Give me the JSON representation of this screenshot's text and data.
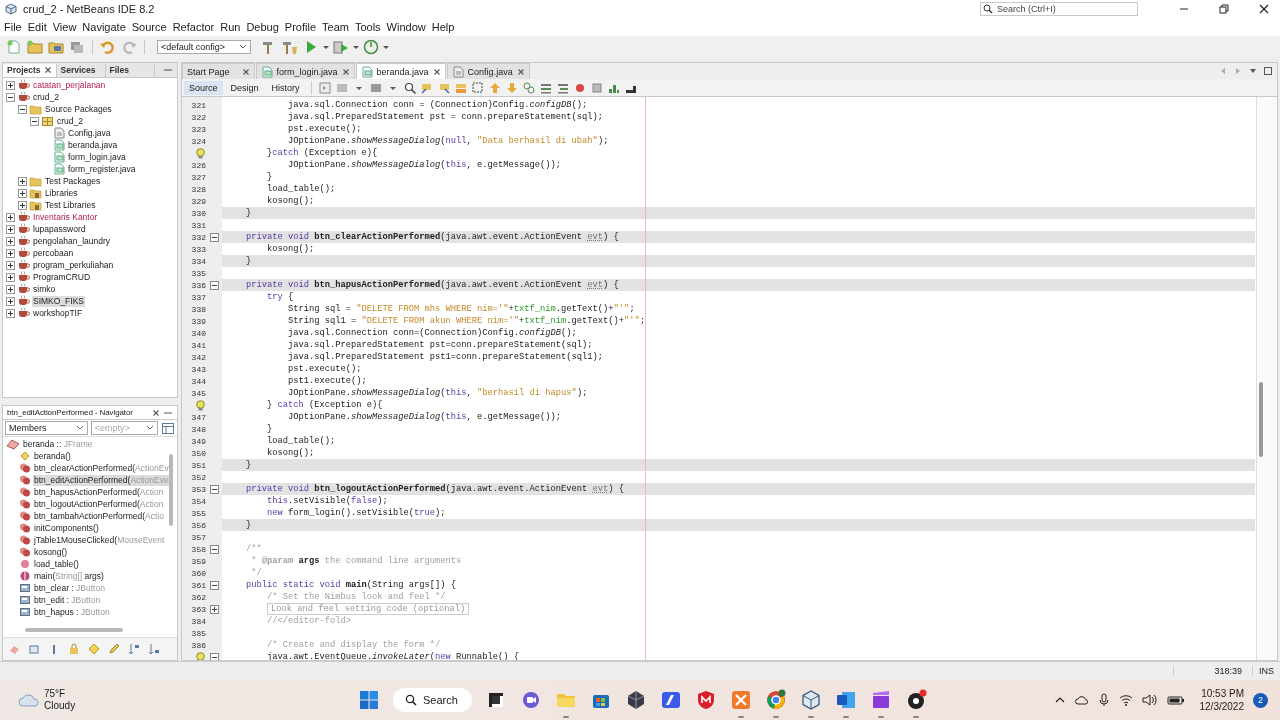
{
  "window": {
    "title": "crud_2 - NetBeans IDE 8.2",
    "search_placeholder": "Search (Ctrl+I)"
  },
  "menu": [
    "File",
    "Edit",
    "View",
    "Navigate",
    "Source",
    "Refactor",
    "Run",
    "Debug",
    "Profile",
    "Team",
    "Tools",
    "Window",
    "Help"
  ],
  "toolbar": {
    "config": "<default config>"
  },
  "projects_panel": {
    "tabs": [
      {
        "label": "Projects",
        "selected": true
      },
      {
        "label": "Services",
        "selected": false
      },
      {
        "label": "Files",
        "selected": false
      }
    ],
    "tree": [
      {
        "label": "catatan_perjalanan",
        "kind": "project",
        "error": true,
        "expanded": false,
        "selected": false
      },
      {
        "label": "crud_2",
        "kind": "project",
        "error": false,
        "expanded": true,
        "selected": false,
        "children": [
          {
            "label": "Source Packages",
            "kind": "folder",
            "error": false,
            "expanded": true,
            "selected": false,
            "children": [
              {
                "label": "crud_2",
                "kind": "package",
                "error": false,
                "expanded": true,
                "selected": false,
                "children": [
                  {
                    "label": "Config.java",
                    "kind": "class",
                    "error": false,
                    "selected": false
                  },
                  {
                    "label": "beranda.java",
                    "kind": "form",
                    "error": false,
                    "selected": false
                  },
                  {
                    "label": "form_login.java",
                    "kind": "form",
                    "error": false,
                    "selected": false
                  },
                  {
                    "label": "form_register.java",
                    "kind": "form",
                    "error": false,
                    "selected": false
                  }
                ]
              }
            ]
          },
          {
            "label": "Test Packages",
            "kind": "folder",
            "error": false,
            "expanded": false,
            "selected": false
          },
          {
            "label": "Libraries",
            "kind": "library",
            "error": false,
            "expanded": false,
            "selected": false
          },
          {
            "label": "Test Libraries",
            "kind": "library",
            "error": false,
            "expanded": false,
            "selected": false
          }
        ]
      },
      {
        "label": "Inventaris Kantor",
        "kind": "project",
        "error": true,
        "expanded": false,
        "selected": false
      },
      {
        "label": "lupapassword",
        "kind": "project",
        "error": false,
        "expanded": false,
        "selected": false
      },
      {
        "label": "pengolahan_laundry",
        "kind": "project",
        "error": false,
        "expanded": false,
        "selected": false
      },
      {
        "label": "percobaan",
        "kind": "project",
        "error": false,
        "expanded": false,
        "selected": false
      },
      {
        "label": "program_perkuliahan",
        "kind": "project",
        "error": false,
        "expanded": false,
        "selected": false
      },
      {
        "label": "ProgramCRUD",
        "kind": "project",
        "error": false,
        "expanded": false,
        "selected": false
      },
      {
        "label": "simko",
        "kind": "project",
        "error": false,
        "expanded": false,
        "selected": false
      },
      {
        "label": "SIMKO_FIKS",
        "kind": "project",
        "error": false,
        "expanded": false,
        "selected": true
      },
      {
        "label": "workshopTIF",
        "kind": "project",
        "error": false,
        "expanded": false,
        "selected": false
      }
    ]
  },
  "navigator": {
    "title": "btn_editActionPerformed - Navigator",
    "filter": "Members",
    "secondary": "<empty>",
    "root": {
      "kind": "frame",
      "name": "beranda :: ",
      "detail": "JFrame"
    },
    "members": [
      {
        "kind": "constructor",
        "name": "beranda()",
        "selected": false
      },
      {
        "kind": "private",
        "name": "btn_clearActionPerformed(",
        "detail": "ActionEv",
        "selected": false
      },
      {
        "kind": "private",
        "name": "btn_editActionPerformed(",
        "detail": "ActionEve",
        "selected": true
      },
      {
        "kind": "private",
        "name": "btn_hapusActionPerformed(",
        "detail": "Action",
        "selected": false
      },
      {
        "kind": "private",
        "name": "btn_logoutActionPerformed(",
        "detail": "Action",
        "selected": false
      },
      {
        "kind": "private",
        "name": "btn_tambahActionPerformed(",
        "detail": "Actio",
        "selected": false
      },
      {
        "kind": "private",
        "name": "initComponents()",
        "selected": false
      },
      {
        "kind": "private",
        "name": "jTable1MouseClicked(",
        "detail": "MouseEvent",
        "selected": false
      },
      {
        "kind": "private",
        "name": "kosong()",
        "selected": false
      },
      {
        "kind": "method",
        "name": "load_table()",
        "selected": false
      },
      {
        "kind": "static",
        "name": "main(",
        "detail": "String[]",
        "tail": " args)",
        "selected": false
      },
      {
        "kind": "field",
        "name": "btn_clear : ",
        "detail": "JButton",
        "selected": false
      },
      {
        "kind": "field",
        "name": "btn_edit : ",
        "detail": "JButton",
        "selected": false
      },
      {
        "kind": "field",
        "name": "btn_hapus : ",
        "detail": "JButton",
        "selected": false
      }
    ]
  },
  "editor": {
    "tabs": [
      {
        "label": "Start Page",
        "kind": "page",
        "selected": false
      },
      {
        "label": "form_login.java",
        "kind": "form",
        "selected": false
      },
      {
        "label": "beranda.java",
        "kind": "form",
        "selected": true
      },
      {
        "label": "Config.java",
        "kind": "class",
        "selected": false
      }
    ],
    "views": [
      {
        "label": "Source",
        "selected": true
      },
      {
        "label": "Design",
        "selected": false
      },
      {
        "label": "History",
        "selected": false
      }
    ],
    "lines": [
      {
        "num": "321",
        "highlighted": false,
        "code": [
          {
            "kind": "p",
            "text": "            java.sql.Connection conn = (Connection)Config."
          },
          {
            "kind": "it",
            "text": "configDB"
          },
          {
            "kind": "p",
            "text": "();"
          }
        ]
      },
      {
        "num": "322",
        "highlighted": false,
        "code": [
          {
            "kind": "p",
            "text": "            java.sql.PreparedStatement pst = conn.prepareStatement(sql);"
          }
        ]
      },
      {
        "num": "323",
        "highlighted": false,
        "code": [
          {
            "kind": "p",
            "text": "            pst.execute();"
          }
        ]
      },
      {
        "num": "324",
        "highlighted": false,
        "code": [
          {
            "kind": "p",
            "text": "            JOptionPane."
          },
          {
            "kind": "it",
            "text": "showMessageDialog"
          },
          {
            "kind": "p",
            "text": "("
          },
          {
            "kind": "kw",
            "text": "null"
          },
          {
            "kind": "p",
            "text": ", "
          },
          {
            "kind": "str",
            "text": "\"Data berhasil di ubah\""
          },
          {
            "kind": "p",
            "text": ");"
          }
        ]
      },
      {
        "hint": true,
        "highlighted": false,
        "code": [
          {
            "kind": "p",
            "text": "        }"
          },
          {
            "kind": "kw",
            "text": "catch"
          },
          {
            "kind": "p",
            "text": " (Exception e){"
          }
        ]
      },
      {
        "num": "326",
        "highlighted": false,
        "code": [
          {
            "kind": "p",
            "text": "            JOptionPane."
          },
          {
            "kind": "it",
            "text": "showMessageDialog"
          },
          {
            "kind": "p",
            "text": "("
          },
          {
            "kind": "kw",
            "text": "this"
          },
          {
            "kind": "p",
            "text": ", e.getMessage());"
          }
        ]
      },
      {
        "num": "327",
        "highlighted": false,
        "code": [
          {
            "kind": "p",
            "text": "        }"
          }
        ]
      },
      {
        "num": "328",
        "highlighted": false,
        "code": [
          {
            "kind": "p",
            "text": "        load_table();"
          }
        ]
      },
      {
        "num": "329",
        "highlighted": false,
        "code": [
          {
            "kind": "p",
            "text": "        kosong();"
          }
        ]
      },
      {
        "num": "330",
        "highlighted": true,
        "code": [
          {
            "kind": "p",
            "text": "    }"
          }
        ]
      },
      {
        "num": "331",
        "highlighted": false
      },
      {
        "num": "332",
        "highlighted": true,
        "collapsed": false,
        "code": [
          {
            "kind": "kw",
            "text": "    private void "
          },
          {
            "kind": "b",
            "text": "btn_clearActionPerformed"
          },
          {
            "kind": "p",
            "text": "(java.awt.event.ActionEvent "
          },
          {
            "kind": "un",
            "text": "evt"
          },
          {
            "kind": "p",
            "text": ") {"
          }
        ]
      },
      {
        "num": "333",
        "highlighted": false,
        "code": [
          {
            "kind": "p",
            "text": "        kosong();"
          }
        ]
      },
      {
        "num": "334",
        "highlighted": true,
        "code": [
          {
            "kind": "p",
            "text": "    }"
          }
        ]
      },
      {
        "num": "335",
        "highlighted": false
      },
      {
        "num": "336",
        "highlighted": true,
        "collapsed": false,
        "code": [
          {
            "kind": "kw",
            "text": "    private void "
          },
          {
            "kind": "b",
            "text": "btn_hapusActionPerformed"
          },
          {
            "kind": "p",
            "text": "(java.awt.event.ActionEvent "
          },
          {
            "kind": "un",
            "text": "evt"
          },
          {
            "kind": "p",
            "text": ") {"
          }
        ]
      },
      {
        "num": "337",
        "highlighted": false,
        "code": [
          {
            "kind": "kw",
            "text": "        try"
          },
          {
            "kind": "p",
            "text": " {"
          }
        ]
      },
      {
        "num": "338",
        "highlighted": false,
        "code": [
          {
            "kind": "p",
            "text": "            String sql = "
          },
          {
            "kind": "str",
            "text": "\"DELETE FROM mhs WHERE nim='\""
          },
          {
            "kind": "p",
            "text": "+"
          },
          {
            "kind": "fld",
            "text": "txtf_nim"
          },
          {
            "kind": "p",
            "text": ".getText()+"
          },
          {
            "kind": "str",
            "text": "\"'\""
          },
          {
            "kind": "p",
            "text": ";"
          }
        ]
      },
      {
        "num": "339",
        "highlighted": false,
        "code": [
          {
            "kind": "p",
            "text": "            String sql1 = "
          },
          {
            "kind": "str",
            "text": "\"DELETE FROM akun WHERE nim='\""
          },
          {
            "kind": "p",
            "text": "+"
          },
          {
            "kind": "fld",
            "text": "txtf_nim"
          },
          {
            "kind": "p",
            "text": ".getText()+"
          },
          {
            "kind": "str",
            "text": "\"'\""
          },
          {
            "kind": "p",
            "text": ";"
          }
        ]
      },
      {
        "num": "340",
        "highlighted": false,
        "code": [
          {
            "kind": "p",
            "text": "            java.sql.Connection conn=(Connection)Config."
          },
          {
            "kind": "it",
            "text": "configDB"
          },
          {
            "kind": "p",
            "text": "();"
          }
        ]
      },
      {
        "num": "341",
        "highlighted": false,
        "code": [
          {
            "kind": "p",
            "text": "            java.sql.PreparedStatement pst=conn.prepareStatement(sql);"
          }
        ]
      },
      {
        "num": "342",
        "highlighted": false,
        "code": [
          {
            "kind": "p",
            "text": "            java.sql.PreparedStatement pst1=conn.prepareStatement(sql1);"
          }
        ]
      },
      {
        "num": "343",
        "highlighted": false,
        "code": [
          {
            "kind": "p",
            "text": "            pst.execute();"
          }
        ]
      },
      {
        "num": "344",
        "highlighted": false,
        "code": [
          {
            "kind": "p",
            "text": "            pst1.execute();"
          }
        ]
      },
      {
        "num": "345",
        "highlighted": false,
        "code": [
          {
            "kind": "p",
            "text": "            JOptionPane."
          },
          {
            "kind": "it",
            "text": "showMessageDialog"
          },
          {
            "kind": "p",
            "text": "("
          },
          {
            "kind": "kw",
            "text": "this"
          },
          {
            "kind": "p",
            "text": ", "
          },
          {
            "kind": "str",
            "text": "\"berhasil di hapus\""
          },
          {
            "kind": "p",
            "text": ");"
          }
        ]
      },
      {
        "hint": true,
        "highlighted": false,
        "code": [
          {
            "kind": "p",
            "text": "        } "
          },
          {
            "kind": "kw",
            "text": "catch"
          },
          {
            "kind": "p",
            "text": " (Exception e){"
          }
        ]
      },
      {
        "num": "347",
        "highlighted": false,
        "code": [
          {
            "kind": "p",
            "text": "            JOptionPane."
          },
          {
            "kind": "it",
            "text": "showMessageDialog"
          },
          {
            "kind": "p",
            "text": "("
          },
          {
            "kind": "kw",
            "text": "this"
          },
          {
            "kind": "p",
            "text": ", e.getMessage());"
          }
        ]
      },
      {
        "num": "348",
        "highlighted": false,
        "code": [
          {
            "kind": "p",
            "text": "        }"
          }
        ]
      },
      {
        "num": "349",
        "highlighted": false,
        "code": [
          {
            "kind": "p",
            "text": "        load_table();"
          }
        ]
      },
      {
        "num": "350",
        "highlighted": false,
        "code": [
          {
            "kind": "p",
            "text": "        kosong();"
          }
        ]
      },
      {
        "num": "351",
        "highlighted": true,
        "code": [
          {
            "kind": "p",
            "text": "    }"
          }
        ]
      },
      {
        "num": "352",
        "highlighted": false
      },
      {
        "num": "353",
        "highlighted": true,
        "collapsed": false,
        "code": [
          {
            "kind": "kw",
            "text": "    private void "
          },
          {
            "kind": "b",
            "text": "btn_logoutActionPerformed"
          },
          {
            "kind": "p",
            "text": "(java.awt.event.ActionEvent "
          },
          {
            "kind": "un",
            "text": "evt"
          },
          {
            "kind": "p",
            "text": ") {"
          }
        ]
      },
      {
        "num": "354",
        "highlighted": false,
        "code": [
          {
            "kind": "kw",
            "text": "        this"
          },
          {
            "kind": "p",
            "text": ".setVisible("
          },
          {
            "kind": "kw",
            "text": "false"
          },
          {
            "kind": "p",
            "text": ");"
          }
        ]
      },
      {
        "num": "355",
        "highlighted": false,
        "code": [
          {
            "kind": "kw",
            "text": "        new"
          },
          {
            "kind": "p",
            "text": " form_login().setVisible("
          },
          {
            "kind": "kw",
            "text": "true"
          },
          {
            "kind": "p",
            "text": ");"
          }
        ]
      },
      {
        "num": "356",
        "highlighted": true,
        "code": [
          {
            "kind": "p",
            "text": "    }"
          }
        ]
      },
      {
        "num": "357",
        "highlighted": false
      },
      {
        "num": "358",
        "highlighted": false,
        "collapsed": false,
        "code": [
          {
            "kind": "cm",
            "text": "    /**"
          }
        ]
      },
      {
        "num": "359",
        "highlighted": false,
        "code": [
          {
            "kind": "cm",
            "text": "     * "
          },
          {
            "kind": "cmb",
            "text": "@param"
          },
          {
            "kind": "b",
            "text": " args"
          },
          {
            "kind": "cm",
            "text": " the command line arguments"
          }
        ]
      },
      {
        "num": "360",
        "highlighted": false,
        "code": [
          {
            "kind": "cm",
            "text": "     */"
          }
        ]
      },
      {
        "num": "361",
        "highlighted": false,
        "collapsed": false,
        "code": [
          {
            "kind": "kw",
            "text": "    public static void "
          },
          {
            "kind": "b",
            "text": "main"
          },
          {
            "kind": "p",
            "text": "(String args[]) {"
          }
        ]
      },
      {
        "num": "362",
        "highlighted": false,
        "code": [
          {
            "kind": "cm",
            "text": "        /* Set the Nimbus look and feel */"
          }
        ]
      },
      {
        "num": "363",
        "highlighted": false,
        "collapsed": true,
        "code": [
          {
            "kind": "fold",
            "text": "Look and feel setting code (optional)"
          }
        ]
      },
      {
        "num": "384",
        "highlighted": false,
        "code": [
          {
            "kind": "cm",
            "text": "        //</editor-fold>"
          }
        ]
      },
      {
        "num": "385",
        "highlighted": false
      },
      {
        "num": "386",
        "highlighted": false,
        "code": [
          {
            "kind": "cm",
            "text": "        /* Create and display the form */"
          }
        ]
      },
      {
        "hint": true,
        "highlighted": false,
        "collapsed": false,
        "code": [
          {
            "kind": "p",
            "text": "        java.awt.EventQueue."
          },
          {
            "kind": "it",
            "text": "invokeLater"
          },
          {
            "kind": "p",
            "text": "("
          },
          {
            "kind": "kw",
            "text": "new"
          },
          {
            "kind": "p",
            "text": " Runnable() {"
          }
        ]
      }
    ]
  },
  "status_bar": {
    "position": "318:39",
    "mode": "INS"
  },
  "taskbar": {
    "temperature": "75°F",
    "condition": "Cloudy",
    "search": "Search",
    "time": "10:53 PM",
    "date": "12/3/2022",
    "notifications": "2"
  }
}
